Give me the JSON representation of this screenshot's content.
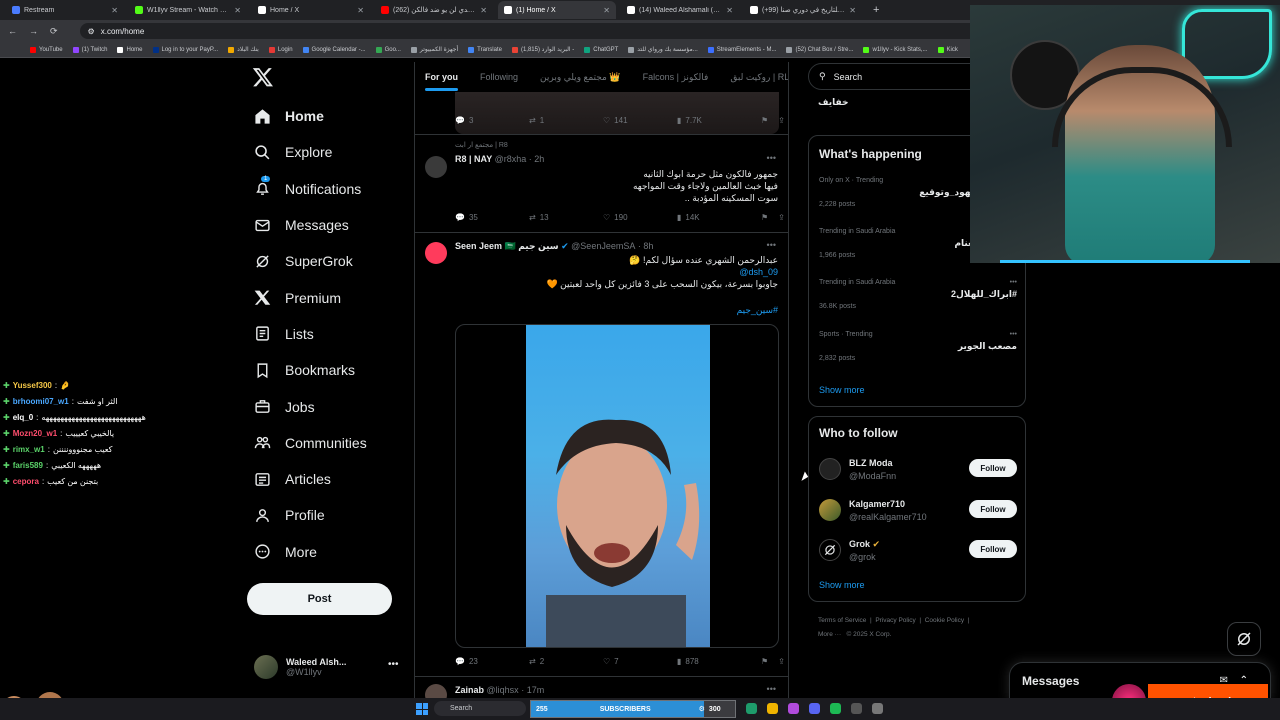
{
  "browser": {
    "tabs": [
      {
        "title": "Restream",
        "color": "#4a7cff",
        "active": false
      },
      {
        "title": "W1llyv Stream - Watch Live on",
        "color": "#53fc18",
        "active": false
      },
      {
        "title": "Home / X",
        "color": "#ffffff",
        "active": false
      },
      {
        "title": "(262) طلوق تحدي لن يو ضد فالكن",
        "color": "#ff0000",
        "active": false
      },
      {
        "title": "(1) Home / X",
        "color": "#ffffff",
        "active": true
      },
      {
        "title": "(14) Waleed Alshamali (@W",
        "color": "#ffffff",
        "active": false
      },
      {
        "title": "(+99) إسارة للتاريخ في دوري صنا",
        "color": "#ffffff",
        "active": false
      }
    ],
    "url": "x.com/home",
    "bookmarks": [
      {
        "label": "YouTube",
        "color": "#ff0000"
      },
      {
        "label": "(1) Twitch",
        "color": "#9146ff"
      },
      {
        "label": "Home",
        "color": "#ffffff"
      },
      {
        "label": "Log in to your PayP...",
        "color": "#003087"
      },
      {
        "label": "بنك البلاد",
        "color": "#f2a900"
      },
      {
        "label": "Login",
        "color": "#e53935"
      },
      {
        "label": "Google Calendar -...",
        "color": "#4285f4"
      },
      {
        "label": "Goo...",
        "color": "#34a853"
      },
      {
        "label": "أجهزة الكمبيوتر",
        "color": "#9aa0a6"
      },
      {
        "label": "Translate",
        "color": "#4285f4"
      },
      {
        "label": "(1,815) البريد الوارد -",
        "color": "#ea4335"
      },
      {
        "label": "ChatGPT",
        "color": "#10a37f"
      },
      {
        "label": "مؤسسة بك ورواي للتد...",
        "color": "#9aa0a6"
      },
      {
        "label": "StreamElements - M...",
        "color": "#3c6fff"
      },
      {
        "label": "(52) Chat Box / Stre...",
        "color": "#9aa0a6"
      },
      {
        "label": "w1llyv - Kick Stats,...",
        "color": "#53fc18"
      },
      {
        "label": "Kick",
        "color": "#53fc18"
      }
    ]
  },
  "nav": {
    "items": [
      {
        "label": "Home",
        "icon": "home-icon",
        "active": true
      },
      {
        "label": "Explore",
        "icon": "search-icon"
      },
      {
        "label": "Notifications",
        "icon": "bell-icon",
        "badge": "1"
      },
      {
        "label": "Messages",
        "icon": "envelope-icon"
      },
      {
        "label": "SuperGrok",
        "icon": "grok-icon"
      },
      {
        "label": "Premium",
        "icon": "x-premium-icon"
      },
      {
        "label": "Lists",
        "icon": "list-icon"
      },
      {
        "label": "Bookmarks",
        "icon": "bookmark-icon"
      },
      {
        "label": "Jobs",
        "icon": "briefcase-icon"
      },
      {
        "label": "Communities",
        "icon": "people-icon"
      },
      {
        "label": "Articles",
        "icon": "article-icon"
      },
      {
        "label": "Profile",
        "icon": "person-icon"
      },
      {
        "label": "More",
        "icon": "more-circle-icon"
      }
    ],
    "post_label": "Post",
    "account": {
      "name": "Waleed Alsh...",
      "handle": "@W1llyv"
    }
  },
  "chat": [
    {
      "user": "Yussef300",
      "msg": "🤌",
      "color": "#f7c948"
    },
    {
      "user": "brhoomi07_w1",
      "msg": "الثر او شفت",
      "color": "#4aa8ff"
    },
    {
      "user": "elq_0",
      "msg": "هههههههههههههههههههههههههههه",
      "color": "#ffffff"
    },
    {
      "user": "Mozn20_w1",
      "msg": "يالخيبي كعيييب",
      "color": "#ff4d6d"
    },
    {
      "user": "rimx_w1",
      "msg": "كعيب مجنوووننننن",
      "color": "#5bd36a"
    },
    {
      "user": "faris589",
      "msg": "هههههه الكعيبي",
      "color": "#5bd36a"
    },
    {
      "user": "cepora",
      "msg": "بتجنن من كعيب",
      "color": "#ff4d6d"
    }
  ],
  "timeline": {
    "tabs": [
      "For you",
      "Following",
      "مجتمع ويلي وبرين 👑",
      "Falcons | فالكونز",
      "روكيت لبق | RL"
    ],
    "top_actions": {
      "replies": "3",
      "reposts": "1",
      "likes": "141",
      "views": "7.7K"
    },
    "tweets": [
      {
        "context": "مجتمع ار ابت | R8",
        "name": "R8 | NAY",
        "handle": "@r8xha",
        "time": "2h",
        "lines": [
          "جمهور فالكون مثل حرمة ابوك الثانيه",
          "فيها خبث العالمين ولاجاء وقت المواجهه",
          "سوت المسكينه المؤدبة .."
        ],
        "replies": "35",
        "reposts": "13",
        "likes": "190",
        "views": "14K"
      },
      {
        "name": "Seen Jeem 🇸🇦 سين جيم",
        "handle": "@SeenJeemSA",
        "time": "8h",
        "lines": [
          "عبدالرحمن الشهري عنده سؤال لكم! 🤔"
        ],
        "mention": "@dsh_09",
        "lines2": [
          "جاوبوا بسرعة، بيكون السحب على 3 فائزين كل واحد لعبتين 🧡"
        ],
        "hashtag": "#سين_جيم",
        "replies": "23",
        "reposts": "2",
        "likes": "7",
        "views": "878"
      },
      {
        "name": "Zainab",
        "handle": "@liqhsx",
        "time": "17m"
      }
    ]
  },
  "right": {
    "search_placeholder": "Search",
    "top_item": "خفايف",
    "happening_title": "What's happening",
    "trends": [
      {
        "category": "Only on X · Trending",
        "name": "#محاجه_شهود_وتوقيع",
        "posts": "2,228 posts"
      },
      {
        "category": "Trending in Saudi Arabia",
        "name": "سلطان_الغنام",
        "posts": "1,966 posts"
      },
      {
        "category": "Trending in Saudi Arabia",
        "name": "#ابراك_للهلال2",
        "posts": "36.8K posts"
      },
      {
        "category": "Sports · Trending",
        "name": "مصعب الجوير",
        "posts": "2,832 posts"
      }
    ],
    "show_more": "Show more",
    "follow_title": "Who to follow",
    "follow": [
      {
        "name": "BLZ Moda",
        "handle": "@ModaFnn"
      },
      {
        "name": "Kalgamer710",
        "handle": "@realKalgamer710"
      },
      {
        "name": "Grok",
        "handle": "@grok"
      }
    ],
    "follow_label": "Follow",
    "footer": [
      "Terms of Service",
      "Privacy Policy",
      "Cookie Policy",
      "More ···",
      "© 2025 X Corp."
    ]
  },
  "messages_label": "Messages",
  "sponsor": "steelseries",
  "taskbar": {
    "search": "Search",
    "subs_count": "255",
    "subs_label": "SUBSCRIBERS",
    "subs_goal": "300",
    "subs_progress": 0.85
  },
  "colors": {
    "accent": "#1d9bf0",
    "bg": "#000000",
    "border": "#2f3336",
    "muted": "#71767b"
  }
}
